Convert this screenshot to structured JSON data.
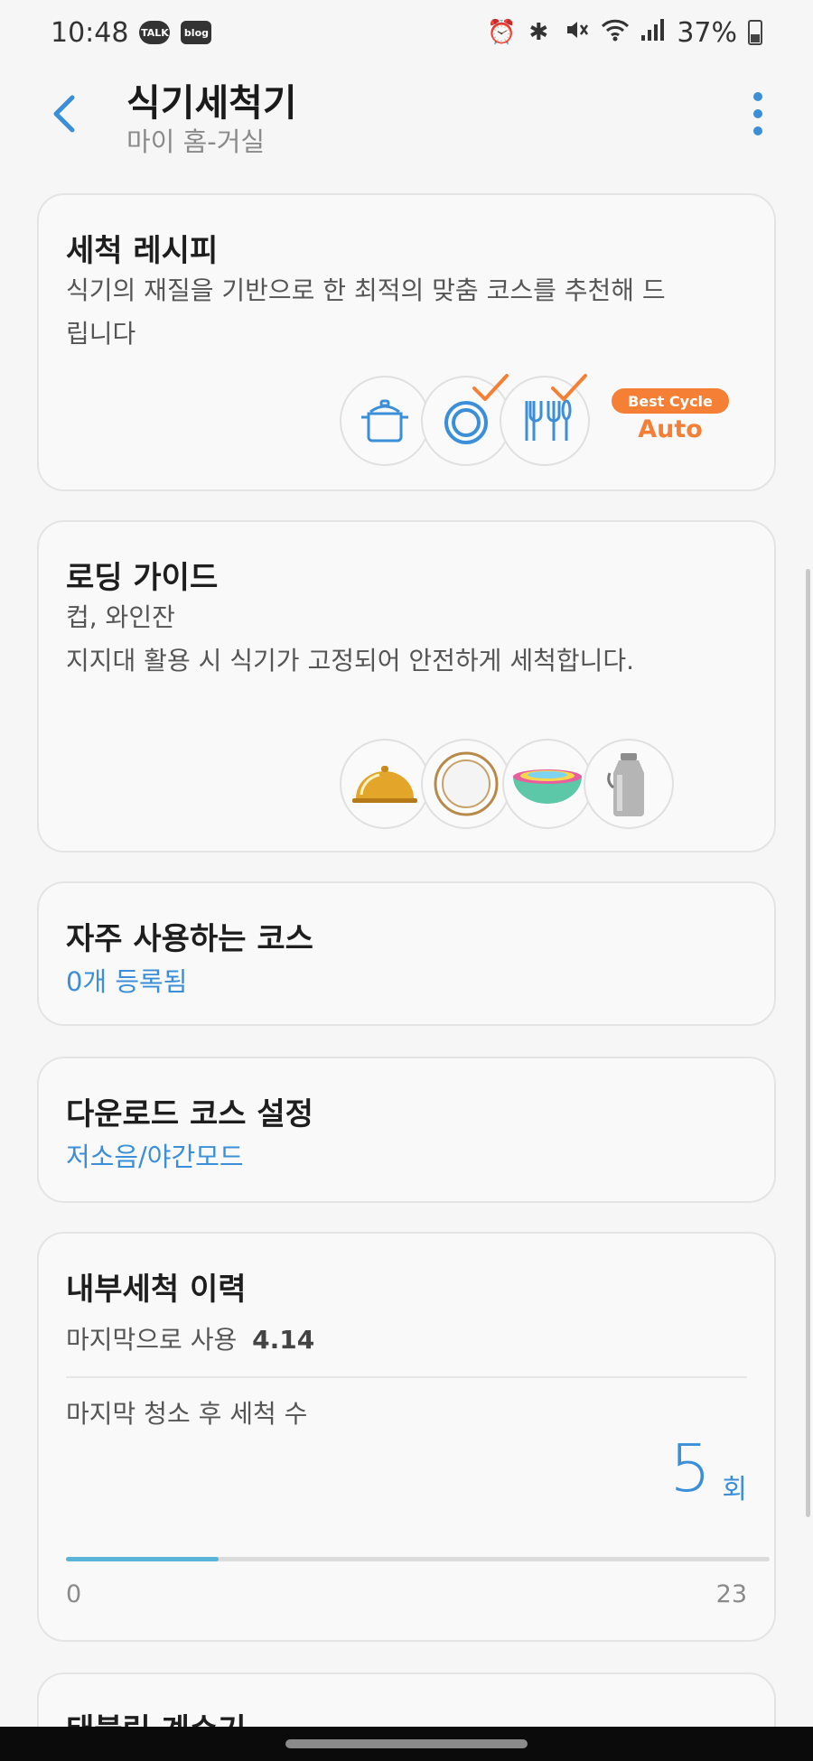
{
  "status_bar": {
    "time": "10:48",
    "talk_badge": "TALK",
    "blog_badge": "blog",
    "battery": "37%",
    "icons": [
      "alarm-icon",
      "bluetooth-icon",
      "mute-icon",
      "wifi-icon",
      "signal-icon",
      "battery-icon"
    ]
  },
  "header": {
    "title": "식기세척기",
    "subtitle": "마이 홈-거실"
  },
  "recipe": {
    "title": "세척 레시피",
    "desc_line1": "식기의 재질을 기반으로 한 최적의 맞춤 코스를 추천해 드",
    "desc_line2": "립니다",
    "best_cycle": "Best Cycle",
    "auto": "Auto",
    "icons": [
      "pot-icon",
      "plate-icon",
      "cutlery-icon"
    ]
  },
  "loading": {
    "title": "로딩 가이드",
    "line1": "컵, 와인잔",
    "line2": "지지대 활용 시 식기가 고정되어 안전하게 세척합니다.",
    "images": [
      "cloche-image",
      "plate-image",
      "bowls-image",
      "milk-can-image"
    ]
  },
  "favorite": {
    "title": "자주 사용하는 코스",
    "value": "0개 등록됨"
  },
  "download": {
    "title": "다운로드 코스 설정",
    "value": "저소음/야간모드"
  },
  "history": {
    "title": "내부세척 이력",
    "last_used_label": "마지막으로 사용",
    "last_used_value": "4.14",
    "count_label": "마지막 청소 후 세척 수",
    "count": "5",
    "unit": "회",
    "progress": {
      "value": 5,
      "min": "0",
      "max": "23"
    }
  },
  "next_card": {
    "title": "태블릿 계수기"
  },
  "colors": {
    "accent": "#3a8fd8",
    "orange": "#f47f35",
    "progress": "#5ab4d9"
  }
}
